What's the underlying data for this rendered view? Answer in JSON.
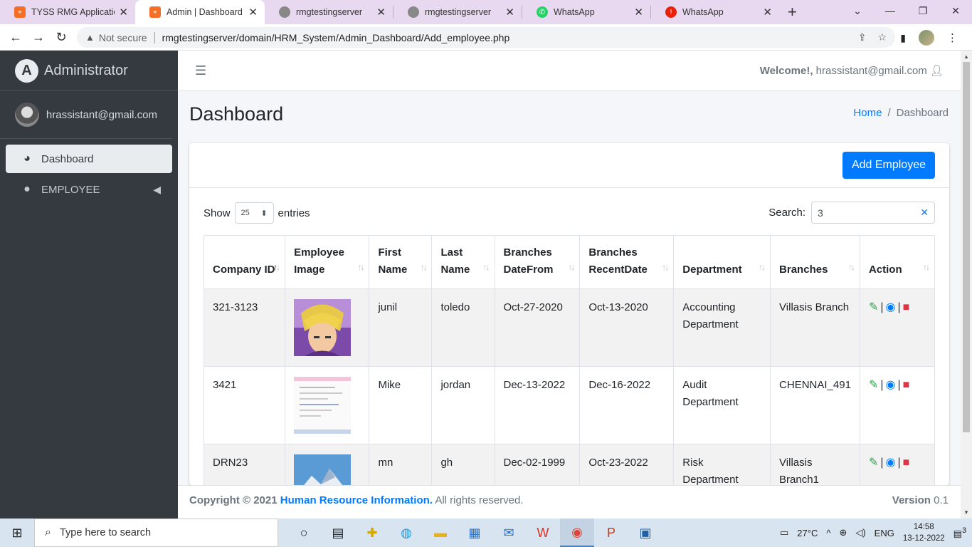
{
  "browser": {
    "tabs": [
      {
        "title": "TYSS RMG Application",
        "icon": "xampp-icon",
        "color": "#f46f25"
      },
      {
        "title": "Admin | Dashboard",
        "icon": "xampp-icon",
        "color": "#f46f25",
        "active": true
      },
      {
        "title": "rmgtestingserver",
        "icon": "globe-icon",
        "color": "#777777"
      },
      {
        "title": "rmgtestingserver",
        "icon": "globe-icon",
        "color": "#777777"
      },
      {
        "title": "WhatsApp",
        "icon": "whatsapp-icon",
        "color": "#25d366"
      },
      {
        "title": "WhatsApp",
        "icon": "alert-icon",
        "color": "#e8220a"
      }
    ],
    "security_label": "Not secure",
    "url": "rmgtestingserver/domain/HRM_System/Admin_Dashboard/Add_employee.php"
  },
  "sidebar": {
    "brand": "Administrator",
    "user": "hrassistant@gmail.com",
    "items": [
      {
        "label": "Dashboard",
        "icon": "dashboard-gauge-icon",
        "active": true
      },
      {
        "label": "EMPLOYEE",
        "icon": "user-icon"
      }
    ]
  },
  "header": {
    "welcome_label": "Welcome!,",
    "welcome_user": "hrassistant@gmail.com"
  },
  "content": {
    "title": "Dashboard",
    "breadcrumb": {
      "home": "Home",
      "current": "Dashboard"
    },
    "add_button": "Add Employee",
    "show_label": "Show",
    "entries_value": "25",
    "entries_label": "entries",
    "search_label": "Search:",
    "search_value": "3"
  },
  "table": {
    "columns": [
      "Company ID",
      "Employee Image",
      "First Name",
      "Last Name",
      "Branches DateFrom",
      "Branches RecentDate",
      "Department",
      "Branches",
      "Action"
    ],
    "rows": [
      {
        "company_id": "321-3123",
        "image": "anime-portrait",
        "first": "junil",
        "last": "toledo",
        "from": "Oct-27-2020",
        "recent": "Oct-13-2020",
        "department": "Accounting Department",
        "branch": "Villasis Branch"
      },
      {
        "company_id": "3421",
        "image": "document-screenshot",
        "first": "Mike",
        "last": "jordan",
        "from": "Dec-13-2022",
        "recent": "Dec-16-2022",
        "department": "Audit Department",
        "branch": "CHENNAI_491"
      },
      {
        "company_id": "DRN23",
        "image": "mountain-photo",
        "first": "mn",
        "last": "gh",
        "from": "Dec-02-1999",
        "recent": "Oct-23-2022",
        "department": "Risk Department",
        "branch": "Villasis Branch1"
      }
    ]
  },
  "footer": {
    "copyright": "Copyright © 2021",
    "org": "Human Resource Information.",
    "rights": "All rights reserved.",
    "version_label": "Version",
    "version": "0.1"
  },
  "taskbar": {
    "search_placeholder": "Type here to search",
    "weather": "27°C",
    "lang": "ENG",
    "time": "14:58",
    "date": "13-12-2022",
    "notifications": "3"
  }
}
